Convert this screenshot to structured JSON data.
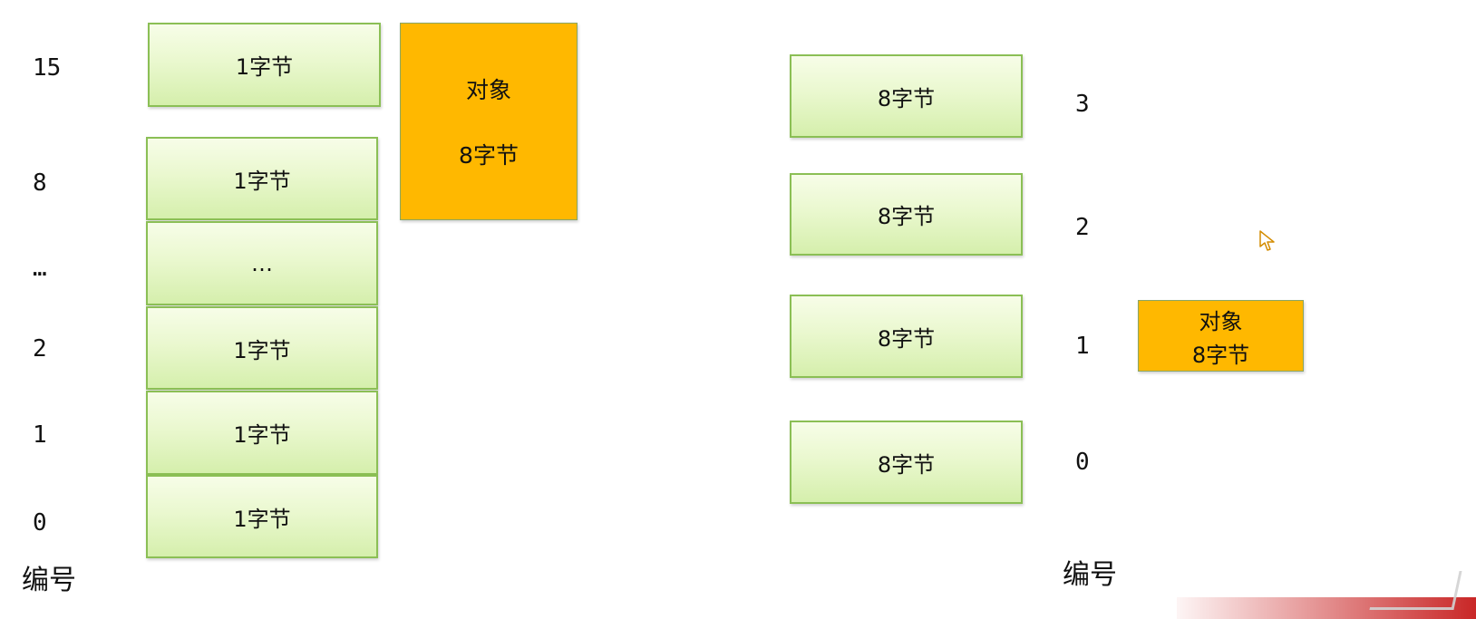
{
  "left_labels": [
    "15",
    "8",
    "…",
    "2",
    "1",
    "0"
  ],
  "left_cells": [
    "1字节",
    "1字节",
    "…",
    "1字节",
    "1字节",
    "1字节"
  ],
  "left_object": {
    "title": "对象",
    "size": "8字节"
  },
  "left_caption": "编号",
  "right_cells": [
    "8字节",
    "8字节",
    "8字节",
    "8字节"
  ],
  "right_labels": [
    "3",
    "2",
    "1",
    "0"
  ],
  "right_object": {
    "title": "对象",
    "size": "8字节"
  },
  "right_caption": "编号",
  "colors": {
    "cell_border": "#8bbf55",
    "cell_fill_top": "#f7fde8",
    "cell_fill_bottom": "#d5efac",
    "object_fill": "#ffb800",
    "text": "#111111"
  },
  "icons": {
    "cursor": "mouse-pointer-icon"
  }
}
